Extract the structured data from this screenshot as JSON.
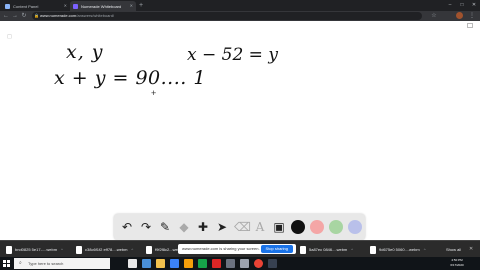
{
  "browser": {
    "tabs": [
      {
        "label": "Content Panel",
        "active": false
      },
      {
        "label": "Numerade Whiteboard",
        "active": true
      }
    ],
    "url_host": "www.numerade.com",
    "url_path": "/answers/whiteboard/"
  },
  "whiteboard": {
    "ink": {
      "line1": "x, y",
      "line2": "x + y = 90.... 1",
      "line3": "x − 52 = y"
    }
  },
  "toolbar": {
    "icons": [
      "undo-icon",
      "redo-icon",
      "pen-icon",
      "shapes-icon",
      "plus-icon",
      "select-icon",
      "eraser-icon",
      "text-icon",
      "image-icon"
    ],
    "colors": [
      "#111111",
      "#f4a6a6",
      "#a8d5a2",
      "#b9c0ea"
    ]
  },
  "downloads": {
    "items": [
      {
        "label": "bnd0825 5e17-....webm"
      },
      {
        "label": "c38c6f1f2 eff78....webm"
      },
      {
        "label": "f9f2f8c2...webm"
      },
      {
        "label": "5a87ec 0846....webm"
      },
      {
        "label": "9d675e0 5060....webm"
      }
    ],
    "share_text": "www.numerade.com is sharing your screen.",
    "stop_label": "Stop sharing",
    "show_all": "Show all"
  },
  "taskbar": {
    "search_placeholder": "Type here to search",
    "time": "4:50 PM",
    "date": "6/17/2020"
  }
}
